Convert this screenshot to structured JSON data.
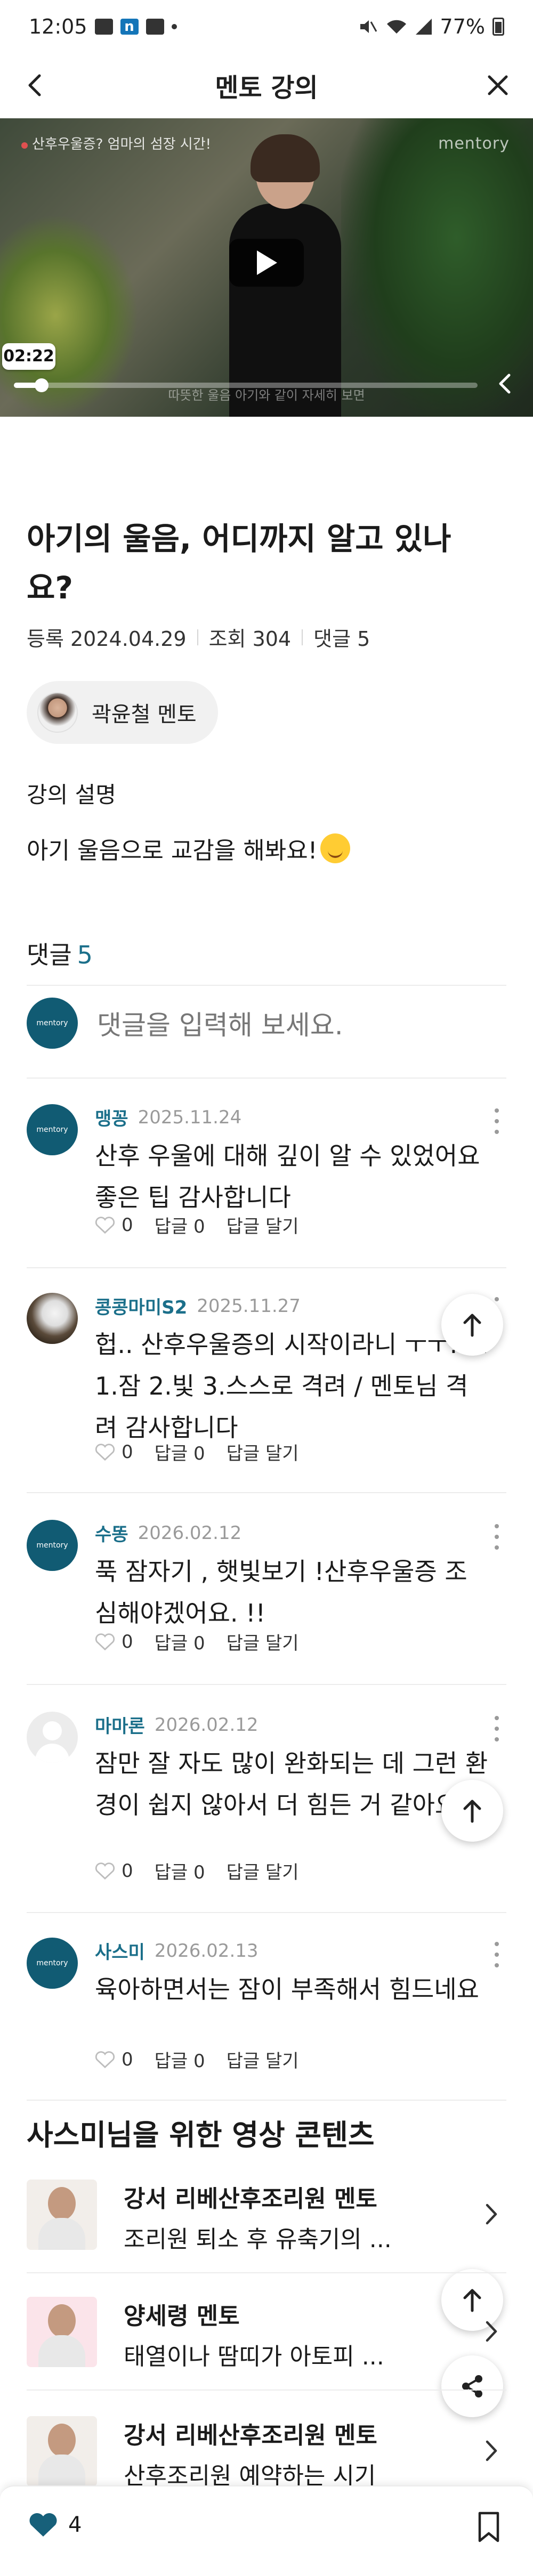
{
  "status_bar": {
    "time": "12:05",
    "battery": "77%"
  },
  "header": {
    "title": "멘토 강의"
  },
  "video": {
    "overlay_title": "산후우울증? 엄마의 섬장 시간!",
    "brand": "mentory",
    "overlay_caption": "따뜻한 울음 아기와 같이 자세히 보면",
    "current_time": "02:22",
    "progress": 0.06
  },
  "lecture": {
    "title": "아기의 울음, 어디까지 알고 있나요?",
    "registered": "등록 2024.04.29",
    "views": "조회 304",
    "comments": "댓글 5",
    "mentor": "곽윤철 멘토",
    "description_label": "강의 설명",
    "description": "아기 울음으로 교감을 해봐요!"
  },
  "comments_section": {
    "label": "댓글",
    "count": "5",
    "input_placeholder": "댓글을 입력해 보세요.",
    "logo_text": "mentory",
    "items": [
      {
        "name": "맹꽁",
        "date": "2025.11.24",
        "text": "산후 우울에 대해 깊이 알 수 있었어요 좋은 팁 감사합니다",
        "likes": "0",
        "replies": "답글 0",
        "reply_action": "답글 달기"
      },
      {
        "name": "콩콩마미S2",
        "date": "2025.11.27",
        "text": "헙.. 산후우울증의 시작이라니 ㅜㅜ..... 1.잠 2.빛 3.스스로 격려 / 멘토님 격려 감사합니다",
        "likes": "0",
        "replies": "답글 0",
        "reply_action": "답글 달기"
      },
      {
        "name": "수똥",
        "date": "2026.02.12",
        "text": "푹 잠자기 , 햇빛보기 !산후우울증 조심해야겠어요. !!",
        "likes": "0",
        "replies": "답글 0",
        "reply_action": "답글 달기"
      },
      {
        "name": "마마론",
        "date": "2026.02.12",
        "text": "잠만 잘 자도 많이 완화되는 데 그런 환경이 쉽지 않아서 더 힘든 거 같아요",
        "likes": "0",
        "replies": "답글 0",
        "reply_action": "답글 달기"
      },
      {
        "name": "사스미",
        "date": "2026.02.13",
        "text": "육아하면서는 잠이 부족해서 힘드네요",
        "likes": "0",
        "replies": "답글 0",
        "reply_action": "답글 달기"
      }
    ]
  },
  "recommendations": {
    "title": "사스미님을 위한 영상 콘텐츠",
    "items": [
      {
        "mentor": "강서 리베산후조리원 멘토",
        "subtitle": "조리원 퇴소 후 유축기의 ..."
      },
      {
        "mentor": "양세령 멘토",
        "subtitle": "태열이나 땀띠가 아토피 ..."
      },
      {
        "mentor": "강서 리베산후조리원 멘토",
        "subtitle": "산후조리원 예약하는 시기"
      }
    ]
  },
  "bottom_bar": {
    "like_count": "4"
  },
  "colors": {
    "accent": "#1b6f8a",
    "brand": "#115b73",
    "like_heart": "#17607a"
  }
}
